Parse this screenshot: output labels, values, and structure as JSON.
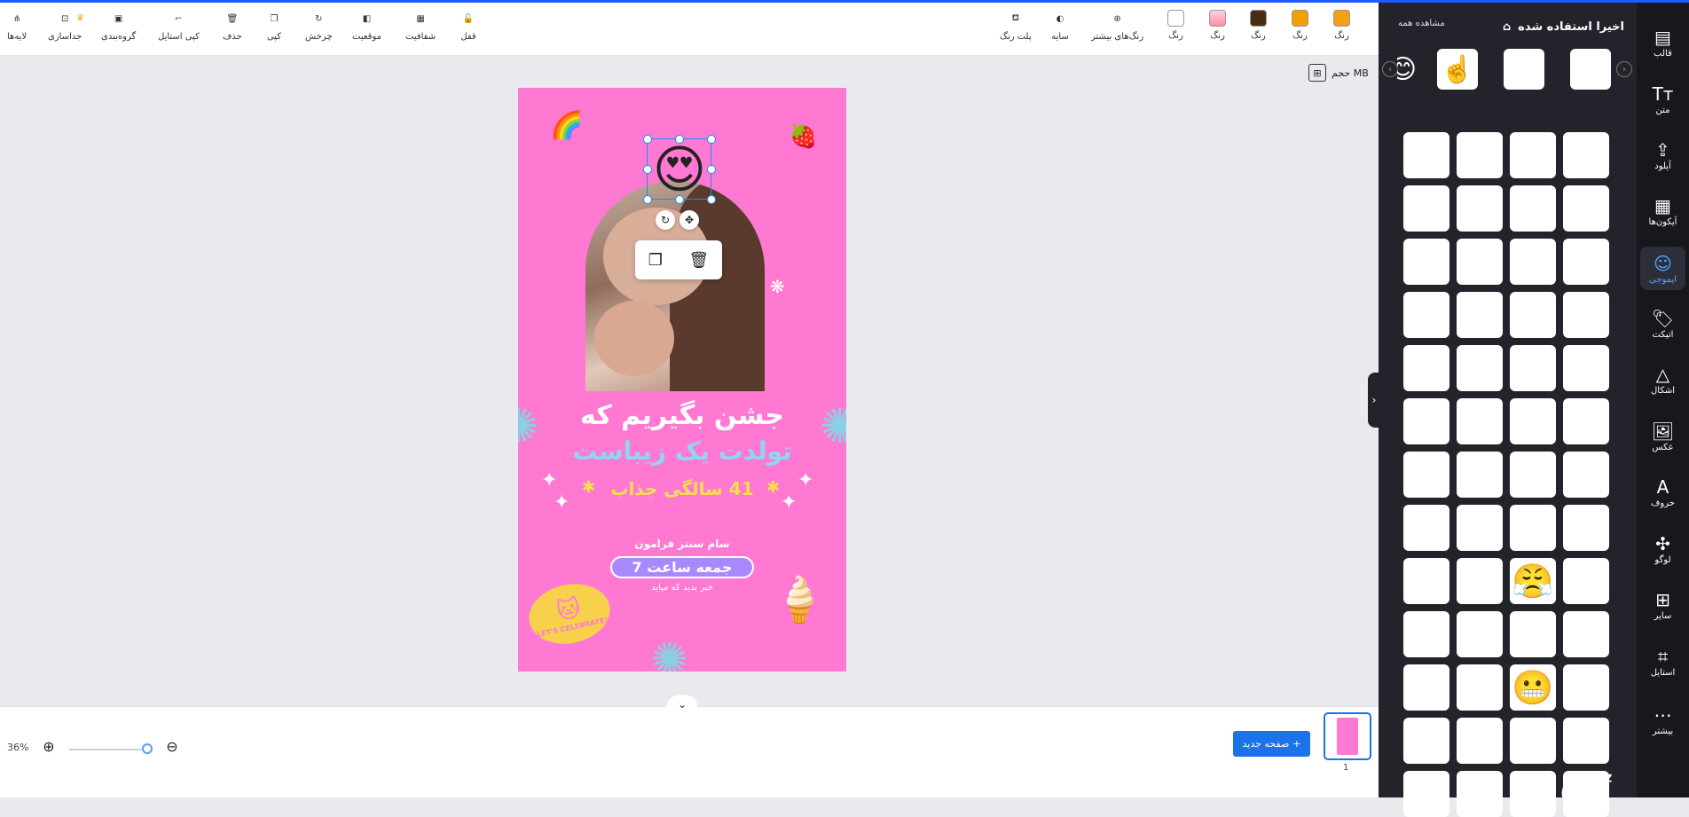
{
  "toolbar": {
    "left_tools": [
      {
        "name": "layers",
        "label": "لایه‌ها",
        "icon": "layers-icon"
      },
      {
        "name": "ungroup",
        "label": "جداسازی",
        "icon": "ungroup-icon"
      },
      {
        "name": "group",
        "label": "گروه‌بندی",
        "icon": "group-icon"
      },
      {
        "name": "copy-style",
        "label": "کپی استایل",
        "icon": "paint-roller-icon"
      },
      {
        "name": "delete",
        "label": "حذف",
        "icon": "trash-icon"
      },
      {
        "name": "copy",
        "label": "کپی",
        "icon": "copy-icon"
      },
      {
        "name": "rotate",
        "label": "چرخش",
        "icon": "rotate-icon"
      },
      {
        "name": "position",
        "label": "موقعیت",
        "icon": "position-icon"
      },
      {
        "name": "transparency",
        "label": "شفافیت",
        "icon": "checker-icon"
      },
      {
        "name": "lock",
        "label": "قفل",
        "icon": "lock-icon"
      }
    ],
    "right_tools": {
      "palette_label": "پلت رنگ",
      "shadow_label": "سایه",
      "more_colors_label": "رنگ‌های بیشتر",
      "color_label": "رنگ"
    },
    "colors": [
      "#ffffff",
      "#ffb3c7",
      "#4a2c14",
      "#f29d00",
      "#f5a010"
    ]
  },
  "canvas": {
    "size_label": "حجم MB",
    "design": {
      "title_line1": "جشن بگیریم که",
      "title_line2": "تولدت یک زیباست",
      "title_line3": "41 سالگی جذاب",
      "venue": "سام سنتر فرامون",
      "time": "جمعه ساعت 7",
      "note": "خبر بدید که میاید",
      "sticker_text": "LET'S CELEBRATE!",
      "background_color": "#ff79d3",
      "selected_emoji": "😍"
    }
  },
  "bottom": {
    "zoom": "36%",
    "new_page_label": "صفحه جدید",
    "page_number": "1"
  },
  "panel": {
    "title": "اخیرا استفاده شده",
    "view_all": "مشاهده همه",
    "recent": [
      "😍",
      "😜",
      "☝️",
      "😊"
    ],
    "emojis": [
      "😀",
      "😀",
      "😁",
      "😅",
      "😇",
      "😉",
      "😂",
      "😄",
      "😋",
      "😌",
      "😍",
      "😆",
      "😐",
      "😑",
      "😘",
      "😊",
      "😓",
      "😒",
      "😎",
      "😏",
      "😗",
      "😙",
      "😕",
      "😔",
      "😛",
      "😜",
      "😝",
      "😖",
      "😟",
      "😠",
      "😡",
      "😚",
      "😣",
      "😢",
      "😤",
      "😞",
      "😨",
      "😧",
      "😦",
      "😢",
      "😪",
      "😫",
      "😬",
      "😩",
      "😰",
      "😯",
      "😔",
      "😮",
      "😱",
      "😯",
      "😳",
      "😴"
    ]
  },
  "rail": [
    {
      "label": "قالب",
      "icon": "template-icon",
      "glyph": "▤"
    },
    {
      "label": "متن",
      "icon": "text-icon",
      "glyph": "Tт"
    },
    {
      "label": "آپلود",
      "icon": "upload-icon",
      "glyph": "⇪"
    },
    {
      "label": "آیکون‌ها",
      "icon": "icons-grid-icon",
      "glyph": "▦"
    },
    {
      "label": "ایموجی",
      "icon": "emoji-icon",
      "glyph": "☺"
    },
    {
      "label": "اتیکت",
      "icon": "tag-icon",
      "glyph": "🏷"
    },
    {
      "label": "اشکال",
      "icon": "shapes-icon",
      "glyph": "△"
    },
    {
      "label": "عکس",
      "icon": "image-icon",
      "glyph": "🖼"
    },
    {
      "label": "حروف",
      "icon": "letter-icon",
      "glyph": "A"
    },
    {
      "label": "لوگو",
      "icon": "logo-icon",
      "glyph": "✣"
    },
    {
      "label": "سایر",
      "icon": "other-icon",
      "glyph": "⊞"
    },
    {
      "label": "استایل",
      "icon": "style-icon",
      "glyph": "⌗"
    },
    {
      "label": "بیشتر",
      "icon": "more-icon",
      "glyph": "⋯"
    }
  ]
}
